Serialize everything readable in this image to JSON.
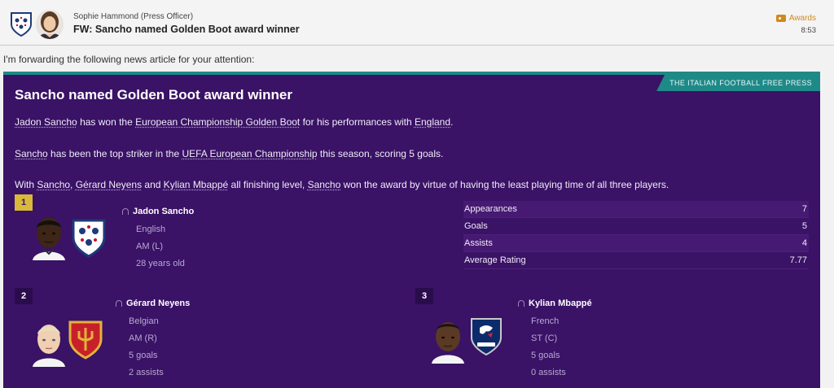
{
  "header": {
    "sender": "Sophie Hammond  (Press Officer)",
    "subject": "FW: Sancho named Golden Boot award winner",
    "tag": "Awards",
    "time": "8:53"
  },
  "intro": "I'm forwarding the following news article for your attention:",
  "article": {
    "publication": "THE ITALIAN FOOTBALL FREE PRESS",
    "title": "Sancho named Golden Boot award winner",
    "p1": {
      "player": "Jadon Sancho",
      "t1": " has won the ",
      "award": "European Championship Golden Boot",
      "t2": " for his performances with ",
      "nation": "England",
      "t3": "."
    },
    "p2": {
      "player": "Sancho",
      "t1": " has been the top striker in the ",
      "competition": "UEFA European Championship",
      "t2": " this season, scoring 5 goals."
    },
    "p3": {
      "t0": "With ",
      "player1": "Sancho",
      "t1": ", ",
      "player2": "Gérard Neyens",
      "t2": " and ",
      "player3": "Kylian Mbappé",
      "t3": " all finishing level, ",
      "player4": "Sancho",
      "t4": " won the award by virtue of having the least playing time of all three players."
    },
    "winner": {
      "rank": "1",
      "name": "Jadon Sancho",
      "nationality": "English",
      "position": "AM (L)",
      "age": "28 years old",
      "stats": [
        {
          "label": "Appearances",
          "value": "7"
        },
        {
          "label": "Goals",
          "value": "5"
        },
        {
          "label": "Assists",
          "value": "4"
        },
        {
          "label": "Average Rating",
          "value": "7.77"
        }
      ]
    },
    "second": {
      "rank": "2",
      "name": "Gérard Neyens",
      "nationality": "Belgian",
      "position": "AM (R)",
      "goals": "5 goals",
      "assists": "2 assists"
    },
    "third": {
      "rank": "3",
      "name": "Kylian Mbappé",
      "nationality": "French",
      "position": "ST (C)",
      "goals": "5 goals",
      "assists": "0 assists"
    }
  },
  "colors": {
    "article_bg": "#3a1266",
    "accent_teal": "#1e8a88",
    "rank_gold": "#d8b93a",
    "tag_orange": "#d08a1c"
  }
}
